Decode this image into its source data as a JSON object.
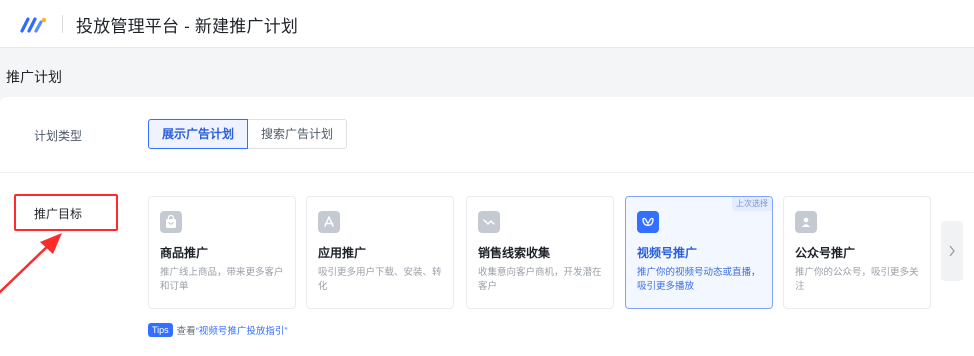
{
  "header": {
    "title": "投放管理平台 - 新建推广计划"
  },
  "section": {
    "title": "推广计划"
  },
  "plan_type": {
    "label": "计划类型",
    "options": [
      "展示广告计划",
      "搜索广告计划"
    ],
    "selected": "展示广告计划"
  },
  "goal": {
    "label": "推广目标",
    "cards": [
      {
        "name": "商品推广",
        "desc": "推广线上商品，带来更多客户和订单",
        "icon": "shopping-bag-icon"
      },
      {
        "name": "应用推广",
        "desc": "吸引更多用户下载、安装、转化",
        "icon": "app-icon"
      },
      {
        "name": "销售线索收集",
        "desc": "收集意向客户商机，开发潜在客户",
        "icon": "leads-icon"
      },
      {
        "name": "视频号推广",
        "desc": "推广你的视频号动态或直播，吸引更多播放",
        "icon": "channels-icon",
        "tag": "上次选择"
      },
      {
        "name": "公众号推广",
        "desc": "推广你的公众号，吸引更多关注",
        "icon": "official-account-icon"
      }
    ],
    "selected_index": 3
  },
  "tips": {
    "badge": "Tips",
    "text": "查看",
    "link": "“视频号推广投放指引”"
  },
  "colors": {
    "accent": "#3370ff",
    "highlight": "#ff2b2b"
  }
}
